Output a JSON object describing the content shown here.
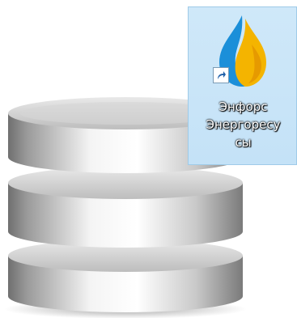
{
  "desktop": {
    "background_graphic": "database-cylinder",
    "shortcut": {
      "icon": "enforce-flame-icon",
      "badge_icon": "shortcut-arrow-icon",
      "label_line1": "Энфорс",
      "label_line2": "Энергоресу",
      "label_line3": "сы",
      "colors": {
        "selection_bg": "#c8e4f8",
        "selection_border": "#9fcbe8",
        "flame_blue": "#1b8fd9",
        "flame_yellow": "#f4b400"
      }
    }
  }
}
